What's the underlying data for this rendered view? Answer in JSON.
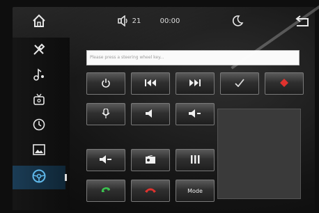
{
  "topbar": {
    "home_icon": "home-icon",
    "volume_icon": "volume-icon",
    "volume_level": "21",
    "time": "00:00",
    "night_mode_icon": "moon-icon",
    "back_icon": "back-arrow-icon"
  },
  "sidebar": {
    "items": [
      {
        "icon": "wrench-screwdriver-icon",
        "active": false
      },
      {
        "icon": "music-note-icon",
        "active": false
      },
      {
        "icon": "tv-icon",
        "active": false
      },
      {
        "icon": "clock-icon",
        "active": false
      },
      {
        "icon": "image-icon",
        "active": false
      },
      {
        "icon": "steering-wheel-icon",
        "active": true
      }
    ]
  },
  "search": {
    "text": "Please press a steering wheel key..."
  },
  "keys": {
    "mode_label": "Mode",
    "red_accent": "#e0322e",
    "green_accent": "#3bbf4f"
  }
}
